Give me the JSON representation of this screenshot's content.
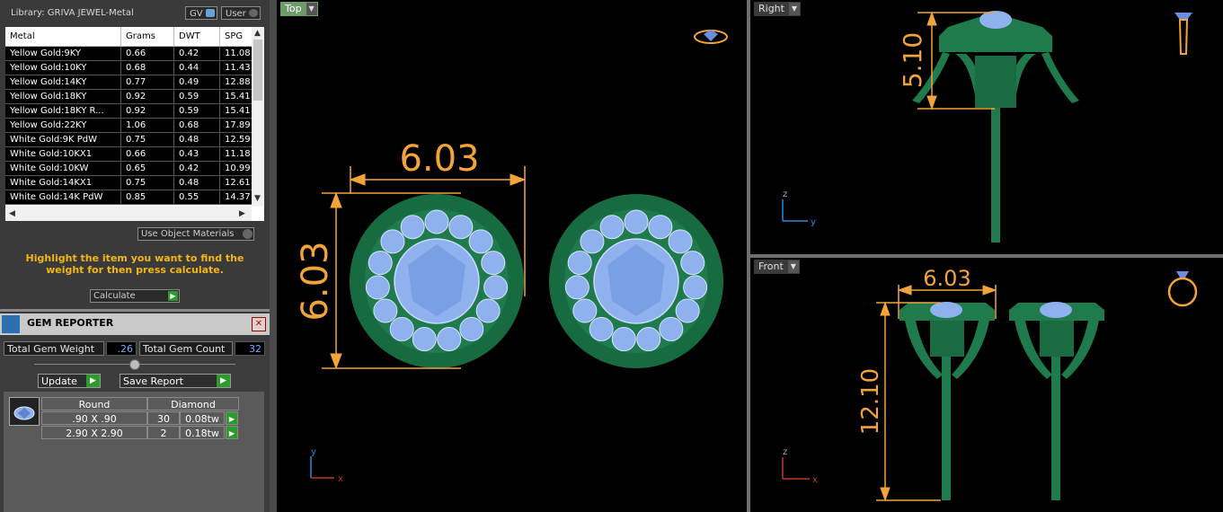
{
  "library": {
    "title": "Library: GRIVA JEWEL-Metal",
    "gv_label": "GV",
    "user_label": "User"
  },
  "metal_table": {
    "headers": [
      "Metal",
      "Grams",
      "DWT",
      "SPG"
    ],
    "rows": [
      [
        "Yellow Gold:9KY",
        "0.66",
        "0.42",
        "11.08"
      ],
      [
        "Yellow Gold:10KY",
        "0.68",
        "0.44",
        "11.43"
      ],
      [
        "Yellow Gold:14KY",
        "0.77",
        "0.49",
        "12.88"
      ],
      [
        "Yellow Gold:18KY",
        "0.92",
        "0.59",
        "15.41"
      ],
      [
        "Yellow Gold:18KY R...",
        "0.92",
        "0.59",
        "15.41"
      ],
      [
        "Yellow Gold:22KY",
        "1.06",
        "0.68",
        "17.89"
      ],
      [
        "White Gold:9K PdW",
        "0.75",
        "0.48",
        "12.59"
      ],
      [
        "White Gold:10KX1",
        "0.66",
        "0.43",
        "11.18"
      ],
      [
        "White Gold:10KW",
        "0.65",
        "0.42",
        "10.99"
      ],
      [
        "White Gold:14KX1",
        "0.75",
        "0.48",
        "12.61"
      ],
      [
        "White Gold:14K PdW",
        "0.85",
        "0.55",
        "14.37"
      ]
    ]
  },
  "use_object_materials": "Use Object Materials",
  "hint": "Highlight the item you want to find the weight for then press calculate.",
  "calculate_label": "Calculate",
  "gem_reporter": {
    "title": "GEM REPORTER",
    "total_weight_label": "Total Gem Weight",
    "total_weight_value": ".26",
    "total_count_label": "Total Gem Count",
    "total_count_value": "32",
    "update_label": "Update",
    "save_report_label": "Save Report",
    "headers": [
      "Round",
      "Diamond"
    ],
    "rows": [
      {
        "size": ".90 X .90",
        "count": "30",
        "weight": "0.08tw"
      },
      {
        "size": "2.90 X 2.90",
        "count": "2",
        "weight": "0.18tw"
      }
    ]
  },
  "viewports": {
    "top": {
      "label": "Top",
      "width_dim": "6.03",
      "height_dim": "6.03",
      "axis_v": "y",
      "axis_h": "x"
    },
    "right": {
      "label": "Right",
      "dim": "5.10",
      "axis_v": "z",
      "axis_h": "y"
    },
    "front": {
      "label": "Front",
      "width_dim": "6.03",
      "height_dim": "12.10",
      "axis_v": "z",
      "axis_h": "x"
    }
  },
  "colors": {
    "metal": "#1f7a4c",
    "stone": "#8fb2ee",
    "dimension": "#f2a43a",
    "active_label": "#6e9b6a"
  }
}
